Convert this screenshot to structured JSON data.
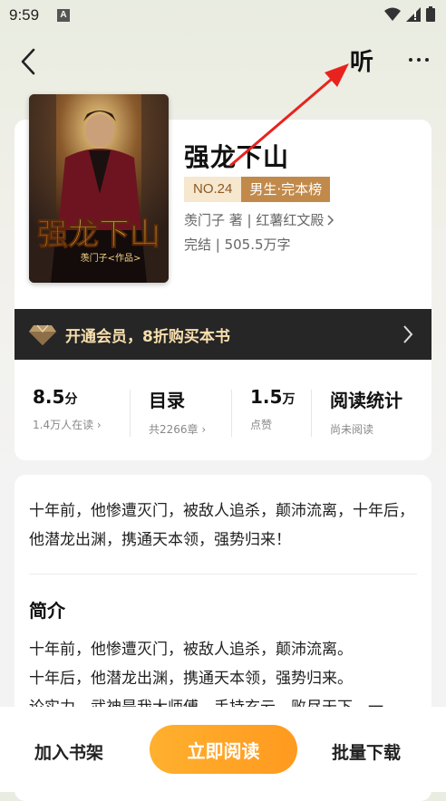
{
  "status_bar": {
    "time": "9:59",
    "notification_icon": "A"
  },
  "nav": {
    "listen_label": "听",
    "back_icon": "chevron-left-icon",
    "more_icon": "more-icon"
  },
  "book": {
    "title": "强龙下山",
    "rank_no": "NO.24",
    "rank_list": "男生·完本榜",
    "author_publisher": "羡门子 著 | 红薯红文殿",
    "status": "完结 | 505.5万字",
    "cover_title": "强龙下山",
    "cover_author": "羡门子<作品>"
  },
  "vip": {
    "text": "开通会员，8折购买本书"
  },
  "stats": [
    {
      "value": "8.5",
      "unit": "分",
      "sub": "1.4万人在读"
    },
    {
      "value": "目录",
      "unit": "",
      "sub": "共2266章"
    },
    {
      "value": "1.5",
      "unit": "万",
      "sub": "点赞"
    },
    {
      "value": "阅读统计",
      "unit": "",
      "sub": "尚未阅读"
    }
  ],
  "description": {
    "tagline": "十年前，他惨遭灭门，被敌人追杀，颠沛流离，十年后，他潜龙出渊，携通天本领，强势归来！",
    "intro_heading": "简介",
    "intro_line1": "十年前，他惨遭灭门，被敌人追杀，颠沛流离。",
    "intro_line2": "十年后，他潜龙出渊，携通天本领，强势归来。",
    "intro_line3": "论实力，武神是我大师傅，手持玄云，败尽天下，一"
  },
  "bottom": {
    "add_shelf": "加入书架",
    "read_now": "立即阅读",
    "batch_download": "批量下载"
  },
  "colors": {
    "accent_orange": "#ffa526",
    "rank_gold": "#c18a4b",
    "vip_dark": "#262626",
    "annotation_red": "#e8231e"
  }
}
